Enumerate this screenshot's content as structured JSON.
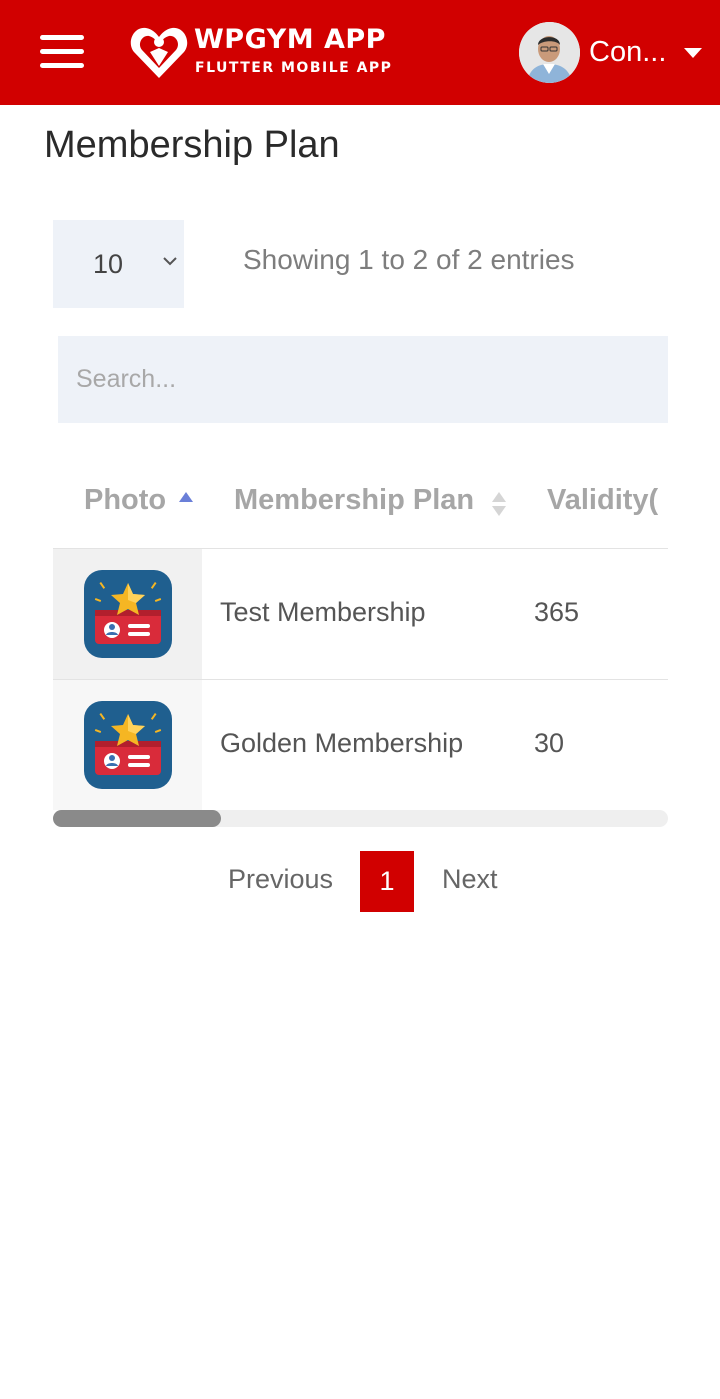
{
  "header": {
    "app_title": "WPGYM APP",
    "app_subtitle": "FLUTTER MOBILE APP",
    "user_name": "Con...",
    "brand_color": "#d10000"
  },
  "page": {
    "title": "Membership Plan"
  },
  "controls": {
    "entries_value": "10",
    "info_text": "Showing 1 to 2 of 2 entries",
    "search_placeholder": "Search..."
  },
  "table": {
    "columns": [
      "Photo",
      "Membership Plan",
      "Validity("
    ],
    "rows": [
      {
        "icon": "membership-card-icon",
        "name": "Test Membership",
        "validity": "365"
      },
      {
        "icon": "membership-card-icon",
        "name": "Golden Membership",
        "validity": "30"
      }
    ]
  },
  "pagination": {
    "previous": "Previous",
    "current": "1",
    "next": "Next"
  }
}
